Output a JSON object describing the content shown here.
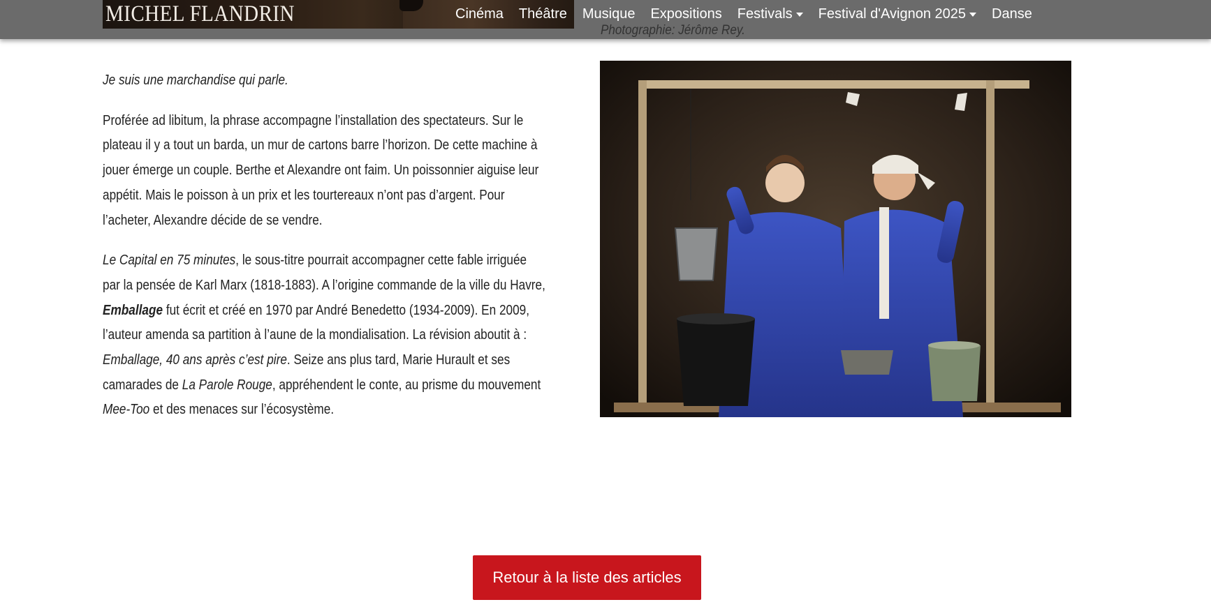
{
  "brand": {
    "name": "MICHEL FLANDRIN"
  },
  "nav": {
    "items": [
      {
        "label": "Cinéma",
        "dropdown": false
      },
      {
        "label": "Théâtre",
        "dropdown": false
      },
      {
        "label": "Musique",
        "dropdown": false
      },
      {
        "label": "Expositions",
        "dropdown": false
      },
      {
        "label": "Festivals",
        "dropdown": true
      },
      {
        "label": "Festival d'Avignon 2025",
        "dropdown": true
      },
      {
        "label": "Danse",
        "dropdown": false
      }
    ]
  },
  "caption": "Photographie: Jérôme Rey.",
  "article": {
    "p1": "Je suis une marchandise qui parle.",
    "p2": [
      "Proférée ad libitum, la phrase accompagne l’installation des spectateurs. Sur le",
      "plateau il y a tout un barda, un mur de cartons barre l’horizon. De cette machine à",
      "jouer émerge un couple. Berthe et Alexandre ont faim. Un poissonnier aiguise leur",
      "appétit. Mais le poisson à un prix et les tourtereaux n’ont pas d’argent. Pour",
      "l’acheter, Alexandre décide de se vendre."
    ],
    "p3": {
      "l1_em": "Le Capital en 75 minutes",
      "l1_rest": ", le sous-titre pourrait accompagner cette fable irriguée",
      "l2": "par la pensée de Karl Marx (1818-1883). A l’origine commande de la ville du Havre,",
      "l3_strong": "Emballage",
      "l3_rest": " fut écrit et créé en 1970 par André Benedetto (1934-2009). En 2009,",
      "l4": "l’auteur amenda sa partition à l’aune de la mondialisation. La révision aboutit à :",
      "l5_em": "Emballage, 40 ans après c’est pire",
      "l5_rest": ". Seize ans plus tard, Marie Hurault et ses",
      "l6_a": "camarades de ",
      "l6_em": "La Parole Rouge",
      "l6_rest": ", appréhendent le conte, au prisme du mouvement",
      "l7_em": "Mee-Too",
      "l7_rest": " et des menaces sur l’écosystème."
    }
  },
  "back_button": {
    "label": "Retour à la liste des articles"
  },
  "colors": {
    "navbar": "#6b6b6b",
    "button": "#c8161d",
    "costume_blue": "#3347b0"
  },
  "icons": [
    "caret-down-icon"
  ]
}
